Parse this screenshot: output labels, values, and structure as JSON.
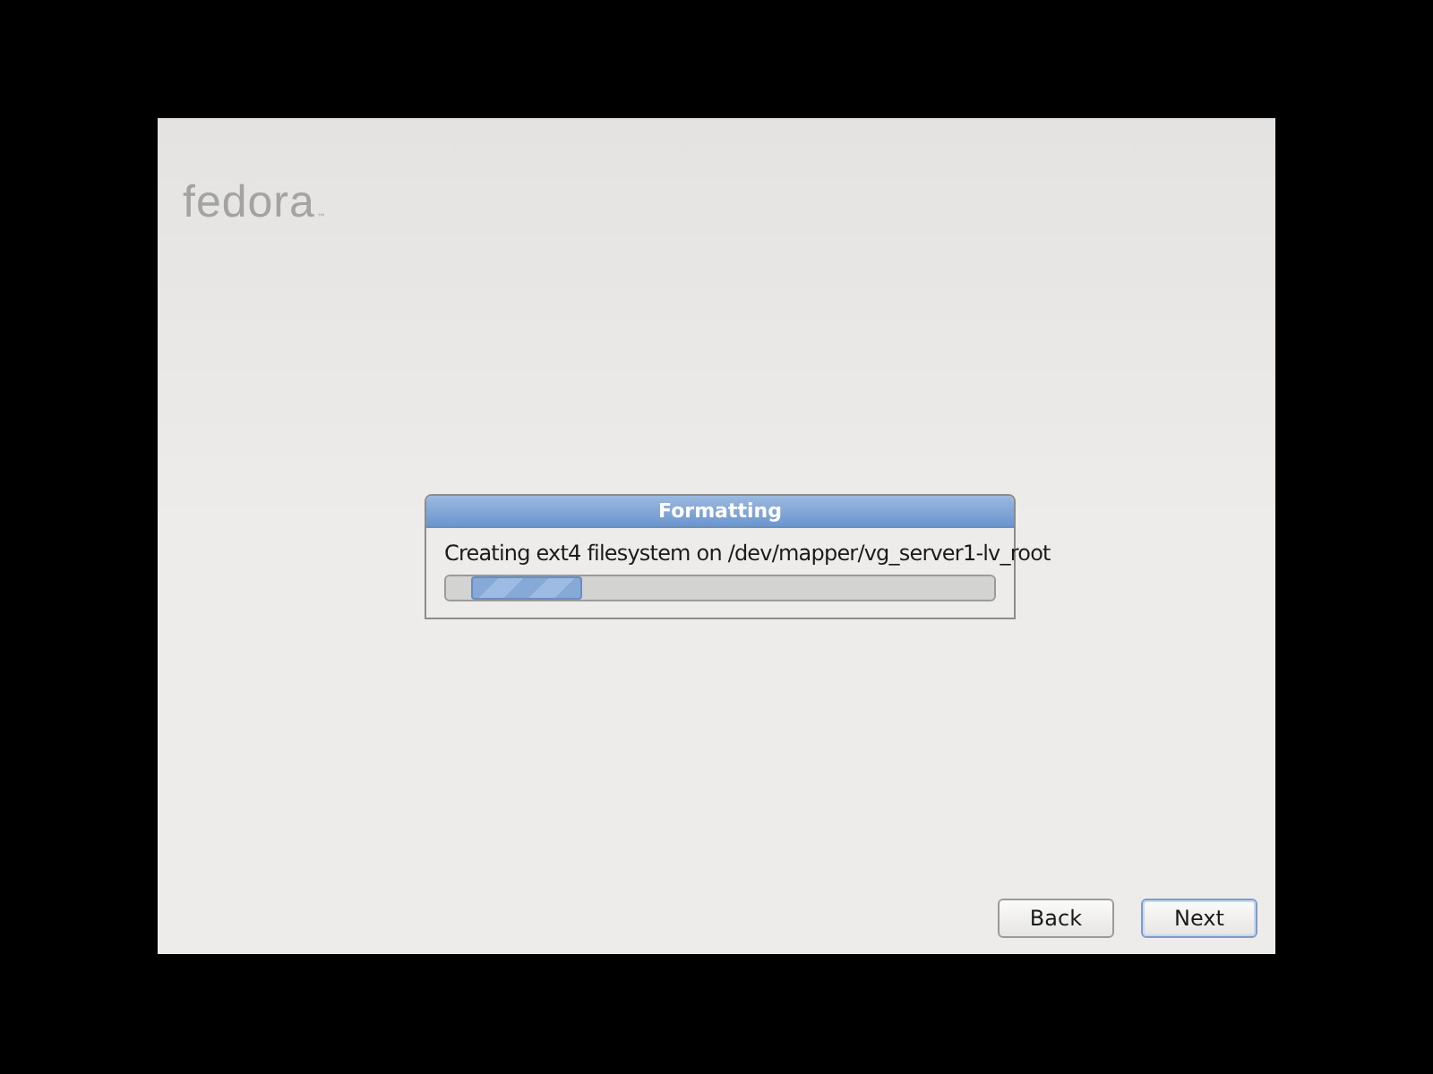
{
  "logo": {
    "text": "fedora",
    "mark": "™"
  },
  "dialog": {
    "title": "Formatting",
    "message": "Creating ext4 filesystem on /dev/mapper/vg_server1-lv_root"
  },
  "buttons": [
    {
      "label": "Back",
      "focused": false
    },
    {
      "label": "Next",
      "focused": true
    }
  ]
}
